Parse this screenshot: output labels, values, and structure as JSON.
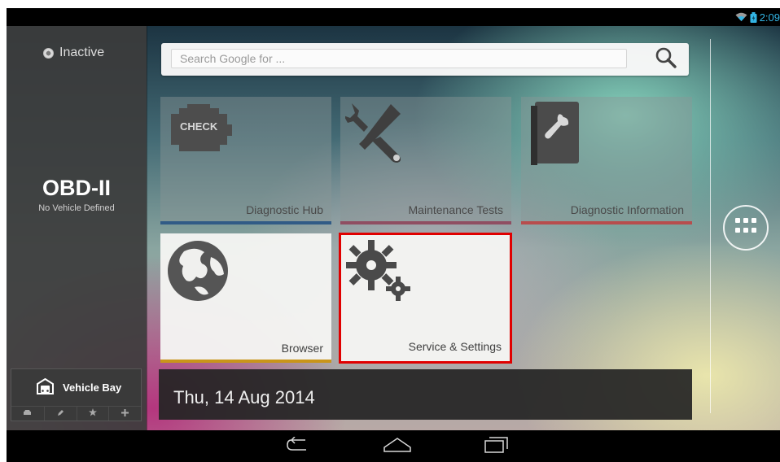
{
  "status_bar": {
    "time": "2:09",
    "icons": [
      "wifi-icon",
      "battery-icon"
    ],
    "color": "#33b5e5"
  },
  "sidebar": {
    "connection_status": "Inactive",
    "protocol": "OBD-II",
    "vehicle_status": "No Vehicle Defined",
    "vehicle_bay": {
      "label": "Vehicle Bay",
      "actions": [
        "vehicle-icon",
        "edit-icon",
        "favorite-icon",
        "add-icon"
      ]
    }
  },
  "search": {
    "placeholder": "Search Google for ...",
    "button_icon": "search-icon"
  },
  "tiles": [
    {
      "label": "Diagnostic Hub",
      "icon": "check-engine-icon",
      "accent": "#315b86"
    },
    {
      "label": "Maintenance Tests",
      "icon": "tools-icon",
      "accent": "#8f4e62"
    },
    {
      "label": "Diagnostic Information",
      "icon": "manual-icon",
      "accent": "#b74d4d"
    },
    {
      "label": "Browser",
      "icon": "globe-icon",
      "accent": "#c9951a"
    },
    {
      "label": "Service & Settings",
      "icon": "settings-icon",
      "accent": "#e00000"
    }
  ],
  "date": "Thu, 14 Aug 2014",
  "navigation": [
    "back-icon",
    "home-icon",
    "recent-apps-icon"
  ],
  "colors": {
    "selection": "#e00000",
    "sidebar": "#3c3c3c",
    "date_bar": "#242424"
  }
}
